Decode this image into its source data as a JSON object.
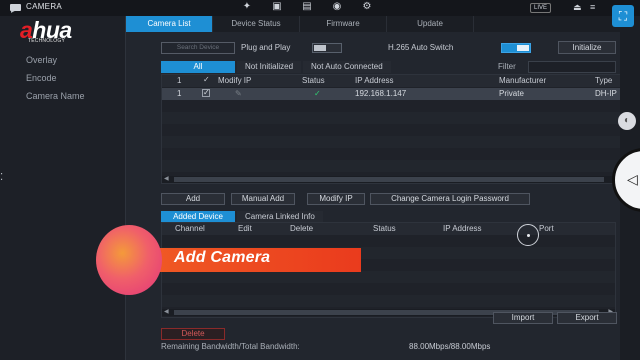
{
  "topbar": {
    "title": "CAMERA",
    "live_label": "LIVE",
    "icons": [
      "network-icon",
      "display-icon",
      "storage-icon",
      "security-icon",
      "account-icon"
    ],
    "icon_glyphs": [
      "✦",
      "▣",
      "▤",
      "◉",
      "⚙"
    ]
  },
  "logo": {
    "brand_a": "a",
    "brand_rest": "hua",
    "tagline": "TECHNOLOGY"
  },
  "sidebar": {
    "items": [
      {
        "label": "Overlay"
      },
      {
        "label": "Encode"
      },
      {
        "label": "Camera Name"
      }
    ]
  },
  "tabs": [
    {
      "label": "Camera List",
      "active": true
    },
    {
      "label": "Device Status",
      "active": false
    },
    {
      "label": "Firmware",
      "active": false
    },
    {
      "label": "Update",
      "active": false
    }
  ],
  "toolbar": {
    "search_label": "Search Device",
    "plug_play_label": "Plug and Play",
    "plug_play_on": false,
    "h265_label": "H.265 Auto Switch",
    "h265_on": true,
    "initialize_label": "Initialize"
  },
  "filter_tabs": [
    {
      "label": "All",
      "active": true
    },
    {
      "label": "Not Initialized",
      "active": false
    },
    {
      "label": "Not Auto Connected",
      "active": false
    }
  ],
  "filter_label": "Filter",
  "device_table": {
    "columns": [
      "Modify IP",
      "Status",
      "IP Address",
      "Manufacturer",
      "Type"
    ],
    "header_index": "1",
    "rows": [
      {
        "index": "1",
        "ip": "192.168.1.147",
        "manufacturer": "Private",
        "type": "DH-IP",
        "checked": true
      }
    ]
  },
  "actions": {
    "add": "Add",
    "manual_add": "Manual Add",
    "modify_ip": "Modify IP",
    "change_password": "Change Camera Login Password"
  },
  "added_tabs": [
    {
      "label": "Added Device",
      "active": true
    },
    {
      "label": "Camera Linked Info",
      "active": false
    }
  ],
  "added_table": {
    "columns": [
      "Channel",
      "Edit",
      "Delete",
      "Status",
      "IP Address",
      "Port"
    ]
  },
  "bottom": {
    "delete_label": "Delete",
    "import_label": "Import",
    "export_label": "Export",
    "bandwidth_label": "Remaining Bandwidth/Total Bandwidth:",
    "bandwidth_value": "88.00Mbps/88.00Mbps"
  },
  "overlay": {
    "title": "Add Camera"
  },
  "colors": {
    "accent": "#1e8fd4",
    "brand_red": "#e41e26",
    "banner": "#ea3b1d",
    "ok": "#2ecc71"
  }
}
